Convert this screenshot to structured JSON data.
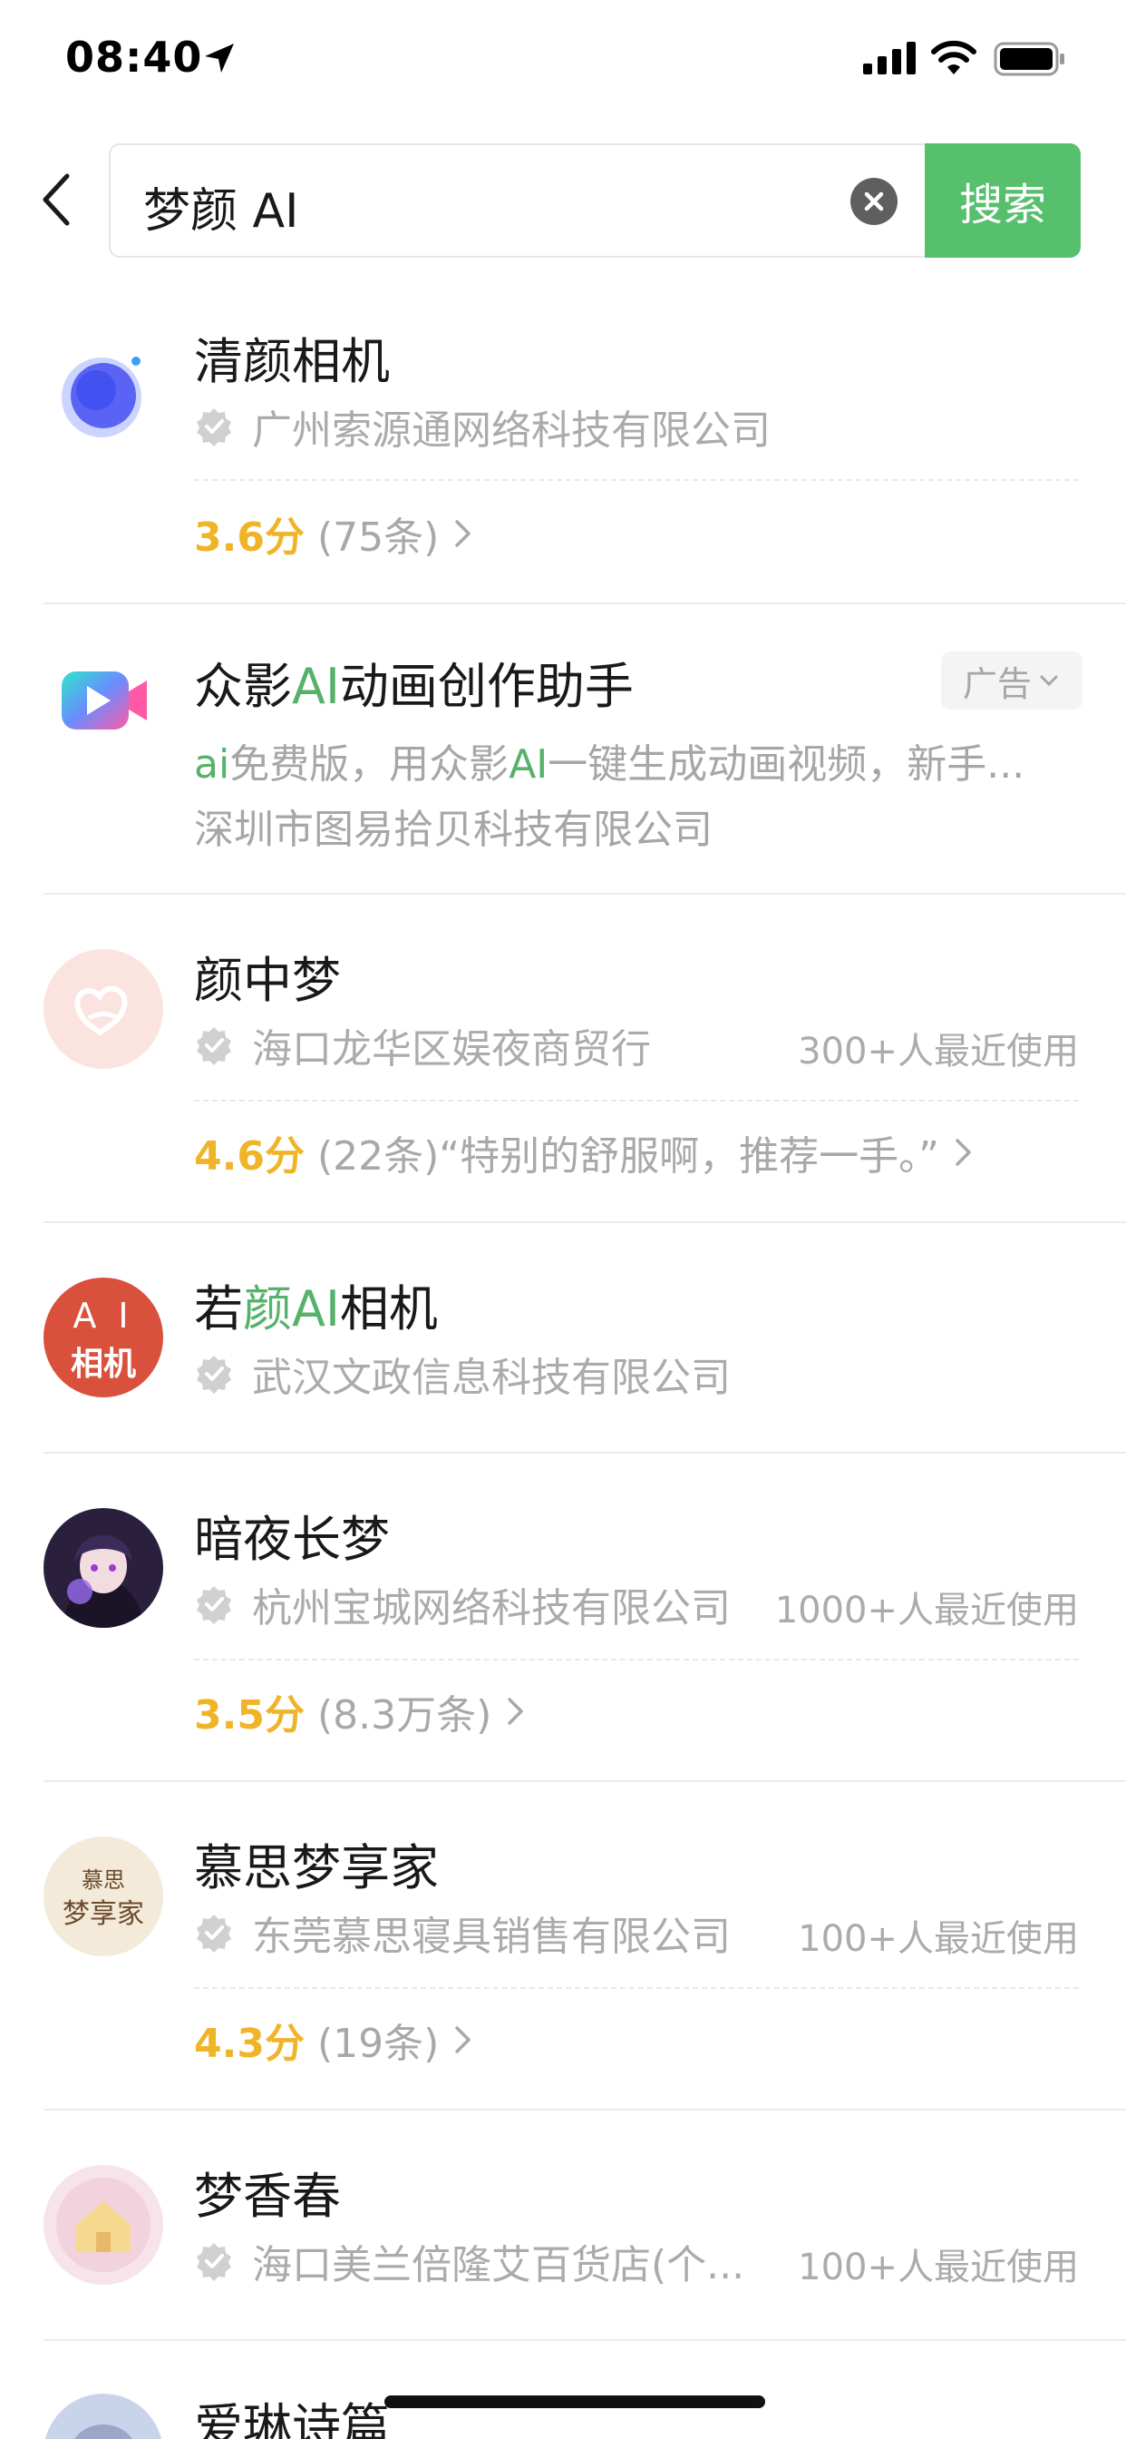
{
  "status_bar": {
    "time": "08:40"
  },
  "search": {
    "query": "梦颜 AI",
    "button_label": "搜索"
  },
  "results": [
    {
      "name": "清颜相机",
      "company": "广州索源通网络科技有限公司",
      "score": "3.6分",
      "reviews": "(75条)"
    },
    {
      "name_pre": "众影",
      "name_hl": "AI",
      "name_post": "动画创作助手",
      "ad_label": "广告",
      "desc_hl1": "ai",
      "desc_mid": "免费版，用众影",
      "desc_hl2": "AI",
      "desc_post": "一键生成动画视频，新手...",
      "company": "深圳市图易拾贝科技有限公司"
    },
    {
      "name": "颜中梦",
      "company": "海口龙华区娱夜商贸行",
      "usage": "300+人最近使用",
      "score": "4.6分",
      "reviews": "(22条)“特别的舒服啊，推荐一手。”"
    },
    {
      "name_pre": "若",
      "name_hl": "颜AI",
      "name_post": "相机",
      "company": "武汉文政信息科技有限公司",
      "logo_text_1": "A I",
      "logo_text_2": "相机"
    },
    {
      "name": "暗夜长梦",
      "company": "杭州宝城网络科技有限公司",
      "usage": "1000+人最近使用",
      "score": "3.5分",
      "reviews": "(8.3万条)"
    },
    {
      "name": "慕思梦享家",
      "company": "东莞慕思寝具销售有限公司",
      "usage": "100+人最近使用",
      "score": "4.3分",
      "reviews": "(19条)",
      "logo_text_1": "慕思",
      "logo_text_2": "梦享家"
    },
    {
      "name": "梦香春",
      "company": "海口美兰倍隆艾百货店(个...",
      "usage": "100+人最近使用"
    },
    {
      "name": "爱琳诗篇"
    }
  ]
}
